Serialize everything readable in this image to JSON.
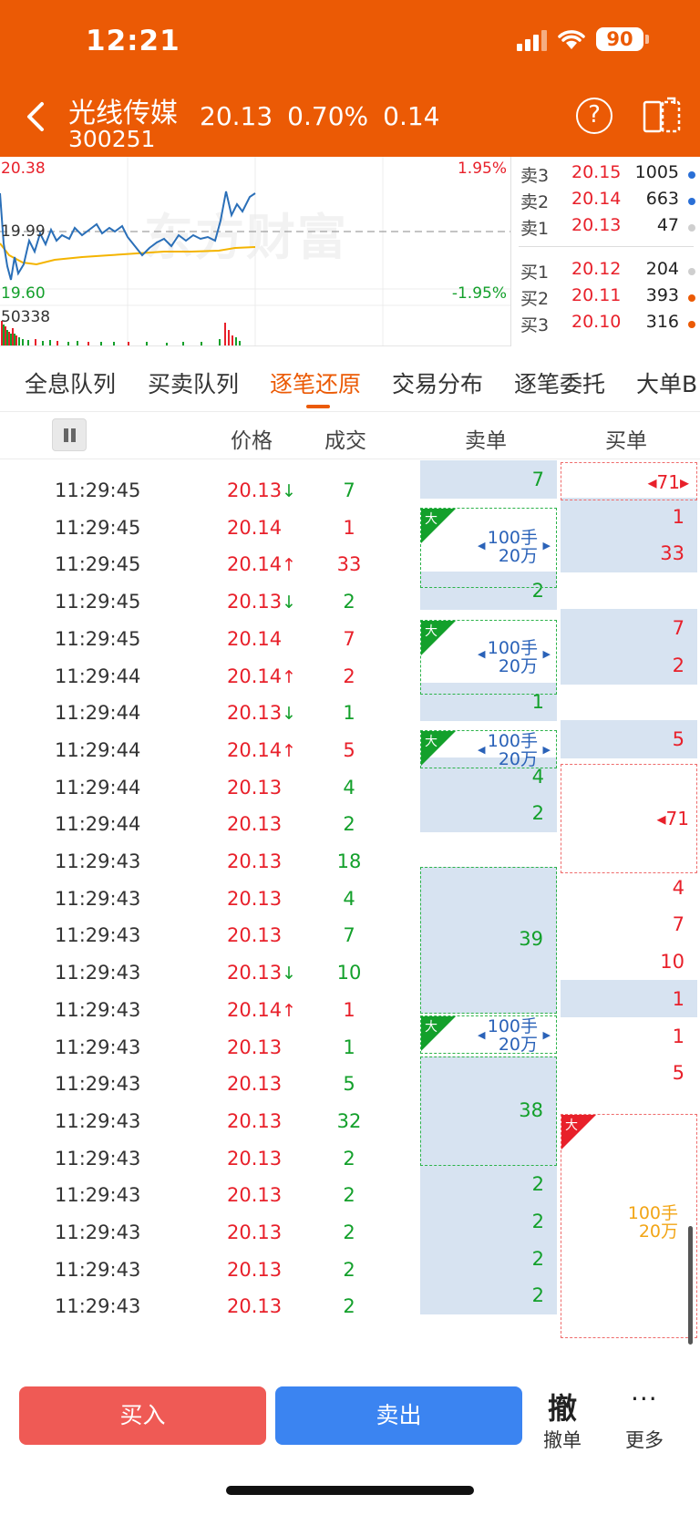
{
  "status": {
    "time": "12:21",
    "battery": "90"
  },
  "header": {
    "name": "光线传媒",
    "code": "300251",
    "price": "20.13",
    "change_pct": "0.70%",
    "change": "0.14",
    "help_icon": "question-circle-icon",
    "switch_icon": "screen-switch-icon"
  },
  "chart": {
    "high_price": "20.38",
    "mid_price": "19.99",
    "low_price": "19.60",
    "high_pct": "1.95%",
    "low_pct": "-1.95%",
    "volume": "50338",
    "watermark": "东方财富"
  },
  "depth": {
    "sell": [
      {
        "label": "卖3",
        "price": "20.15",
        "vol": "1005",
        "dot": "#2a6fd6"
      },
      {
        "label": "卖2",
        "price": "20.14",
        "vol": "663",
        "dot": "#2a6fd6"
      },
      {
        "label": "卖1",
        "price": "20.13",
        "vol": "47",
        "dot": "#cfcfcf"
      }
    ],
    "buy": [
      {
        "label": "买1",
        "price": "20.12",
        "vol": "204",
        "dot": "#cfcfcf"
      },
      {
        "label": "买2",
        "price": "20.11",
        "vol": "393",
        "dot": "#eb5a05"
      },
      {
        "label": "买3",
        "price": "20.10",
        "vol": "316",
        "dot": "#eb5a05"
      }
    ]
  },
  "tabs": [
    "全息队列",
    "买卖队列",
    "逐笔还原",
    "交易分布",
    "逐笔委托",
    "大单B"
  ],
  "active_tab": "逐笔还原",
  "columns": {
    "price": "价格",
    "deal": "成交",
    "sell_order": "卖单",
    "buy_order": "买单"
  },
  "trades": [
    {
      "time": "11:29:45",
      "price": "20.13",
      "arrow": "↓",
      "vol": "7"
    },
    {
      "time": "11:29:45",
      "price": "20.14",
      "arrow": "",
      "vol": "1"
    },
    {
      "time": "11:29:45",
      "price": "20.14",
      "arrow": "↑",
      "vol": "33"
    },
    {
      "time": "11:29:45",
      "price": "20.13",
      "arrow": "↓",
      "vol": "2"
    },
    {
      "time": "11:29:45",
      "price": "20.14",
      "arrow": "",
      "vol": "7"
    },
    {
      "time": "11:29:44",
      "price": "20.14",
      "arrow": "↑",
      "vol": "2"
    },
    {
      "time": "11:29:44",
      "price": "20.13",
      "arrow": "↓",
      "vol": "1"
    },
    {
      "time": "11:29:44",
      "price": "20.14",
      "arrow": "↑",
      "vol": "5"
    },
    {
      "time": "11:29:44",
      "price": "20.13",
      "arrow": "",
      "vol": "4"
    },
    {
      "time": "11:29:44",
      "price": "20.13",
      "arrow": "",
      "vol": "2"
    },
    {
      "time": "11:29:43",
      "price": "20.13",
      "arrow": "",
      "vol": "18"
    },
    {
      "time": "11:29:43",
      "price": "20.13",
      "arrow": "",
      "vol": "4"
    },
    {
      "time": "11:29:43",
      "price": "20.13",
      "arrow": "",
      "vol": "7"
    },
    {
      "time": "11:29:43",
      "price": "20.13",
      "arrow": "↓",
      "vol": "10"
    },
    {
      "time": "11:29:43",
      "price": "20.14",
      "arrow": "↑",
      "vol": "1"
    },
    {
      "time": "11:29:43",
      "price": "20.13",
      "arrow": "",
      "vol": "1"
    },
    {
      "time": "11:29:43",
      "price": "20.13",
      "arrow": "",
      "vol": "5"
    },
    {
      "time": "11:29:43",
      "price": "20.13",
      "arrow": "",
      "vol": "32"
    },
    {
      "time": "11:29:43",
      "price": "20.13",
      "arrow": "",
      "vol": "2"
    },
    {
      "time": "11:29:43",
      "price": "20.13",
      "arrow": "",
      "vol": "2"
    },
    {
      "time": "11:29:43",
      "price": "20.13",
      "arrow": "",
      "vol": "2"
    },
    {
      "time": "11:29:43",
      "price": "20.13",
      "arrow": "",
      "vol": "2"
    },
    {
      "time": "11:29:43",
      "price": "20.13",
      "arrow": "",
      "vol": "2"
    }
  ],
  "order_book": {
    "sell_vals": [
      "7",
      "",
      "",
      "2",
      "",
      "",
      "1",
      "",
      "4",
      "2",
      "",
      "",
      "",
      "",
      "",
      "",
      "",
      "",
      "2",
      "2",
      "2",
      "2",
      "2"
    ],
    "buy_vals": [
      "",
      "1",
      "33",
      "",
      "7",
      "2",
      "",
      "5",
      "",
      "",
      "",
      "4",
      "7",
      "10",
      "1",
      "1",
      "5",
      "",
      "",
      "",
      "",
      "",
      ""
    ],
    "buy_link": "71",
    "sell_merge_1": "39",
    "sell_merge_2": "38",
    "big_tag": "大",
    "big_qty_hand": "100手",
    "big_qty_amount": "20万"
  },
  "bottom": {
    "buy": "买入",
    "sell": "卖出",
    "cancel_icon": "撤",
    "cancel_label": "撤单",
    "more_icon": "···",
    "more_label": "更多"
  }
}
